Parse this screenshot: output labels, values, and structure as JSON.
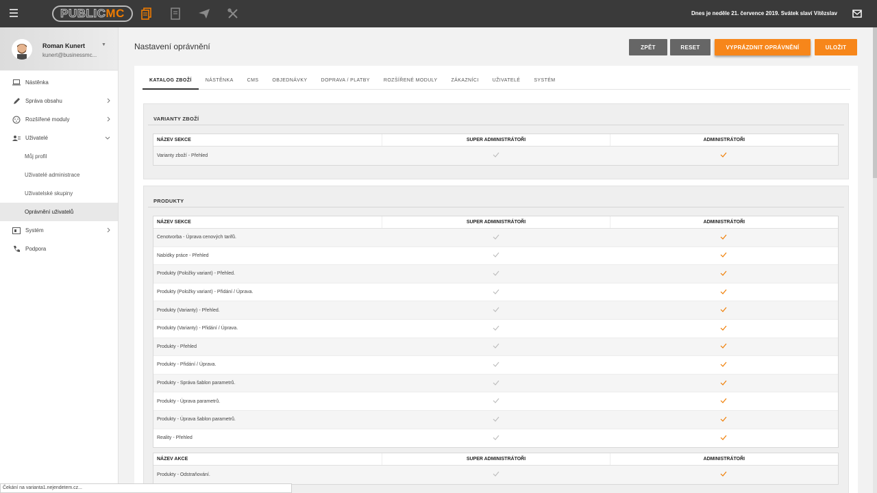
{
  "topbar": {
    "logo_part1": "PUBLIC",
    "logo_part2": "MC",
    "date_text": "Dnes je neděle 21. července 2019. Svátek slaví Vítězslav",
    "colors": {
      "accent": "#f07c00",
      "bar": "#3a3a3a"
    },
    "icons": [
      "menu-icon",
      "documents-icon",
      "page-icon",
      "send-icon",
      "tools-icon",
      "mail-icon"
    ]
  },
  "user": {
    "name": "Roman Kunert",
    "email": "kunert@businessmc..."
  },
  "sidebar": {
    "items": [
      {
        "label": "Nástěnka",
        "icon": "laptop-icon"
      },
      {
        "label": "Správa obsahu",
        "icon": "pencil-icon"
      },
      {
        "label": "Rozšířené moduly",
        "icon": "puzzle-icon"
      },
      {
        "label": "Uživatelé",
        "icon": "users-icon"
      },
      {
        "label": "Systém",
        "icon": "system-icon"
      },
      {
        "label": "Podpora",
        "icon": "phone-icon"
      }
    ],
    "sub_items": [
      "Můj profil",
      "Uživatelé administrace",
      "Uživatelské skupiny",
      "Oprávnění uživatelů"
    ]
  },
  "header": {
    "title": "Nastavení oprávnění",
    "buttons": {
      "back": "ZPĚT",
      "reset": "RESET",
      "clear": "VYPRÁZDNIT OPRÁVNĚNÍ",
      "save": "ULOŽIT"
    }
  },
  "tabs": [
    "KATALOG ZBOŽÍ",
    "NÁSTĚNKA",
    "CMS",
    "OBJEDNÁVKY",
    "DOPRAVA / PLATBY",
    "ROZŠÍŘENÉ MODULY",
    "ZÁKAZNÍCI",
    "UŽIVATELÉ",
    "SYSTÉM"
  ],
  "panels": {
    "variants": {
      "title": "VARIANTY ZBOŽÍ",
      "col1": "NÁZEV SEKCE",
      "col2": "SUPER ADMINISTRÁTOŘI",
      "col3": "ADMINISTRÁTOŘI",
      "rows": [
        "Varianty zboží - Přehled"
      ]
    },
    "products": {
      "title": "PRODUKTY",
      "col1": "NÁZEV SEKCE",
      "col2": "SUPER ADMINISTRÁTOŘI",
      "col3": "ADMINISTRÁTOŘI",
      "rows": [
        "Cenotvorba - Úprava cenových tarifů.",
        "Nabídky práce - Přehled",
        "Produkty (Položky variant) - Přehled.",
        "Produkty (Položky variant) - Přidání / Úprava.",
        "Produkty (Varianty) - Přehled.",
        "Produkty (Varianty) - Přidání / Úprava.",
        "Produkty - Přehled",
        "Produkty - Přidání / Úprava.",
        "Produkty - Správa šablon parametrů.",
        "Produkty - Úprava parametrů.",
        "Produkty - Úprava šablon parametrů.",
        "Reality - Přehled"
      ],
      "action_col1": "NÁZEV AKCE",
      "action_rows": [
        "Produkty - Odstraňování."
      ]
    }
  },
  "status_text": "Čekání na varianta1.nejendetem.cz..."
}
